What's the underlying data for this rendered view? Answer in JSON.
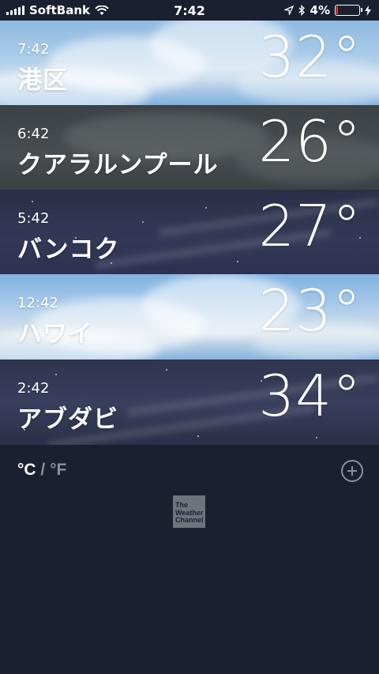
{
  "status_bar": {
    "carrier": "SoftBank",
    "time": "7:42",
    "battery": "4%",
    "battery_level": 0.04,
    "icons": [
      "signal-icon",
      "wifi-icon",
      "location-arrow-icon",
      "bluetooth-icon",
      "battery-icon",
      "charging-icon"
    ]
  },
  "cities": [
    {
      "time": "7:42",
      "name": "港区",
      "temp": "32°"
    },
    {
      "time": "6:42",
      "name": "クアラルンプール",
      "temp": "26°"
    },
    {
      "time": "5:42",
      "name": "バンコク",
      "temp": "27°"
    },
    {
      "time": "12:42",
      "name": "ハワイ",
      "temp": "23°"
    },
    {
      "time": "2:42",
      "name": "アブダビ",
      "temp": "34°"
    }
  ],
  "footer": {
    "unit_c": "°C",
    "unit_sep": "/",
    "unit_f": "°F",
    "logo_text": "The Weather Channel",
    "logo_lines": [
      "The",
      "Weather",
      "Channel"
    ]
  },
  "colors": {
    "background": "#1b2031",
    "battery_low": "#ff3b30",
    "muted": "#8a8f9c"
  }
}
